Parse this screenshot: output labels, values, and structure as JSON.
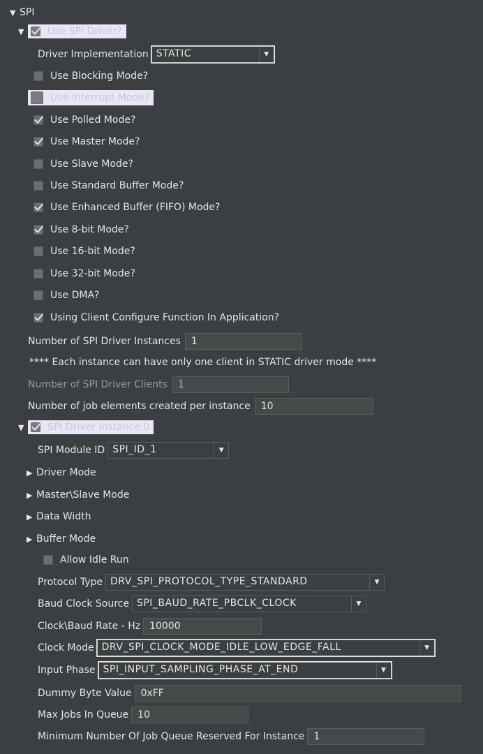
{
  "tree": {
    "root": "SPI",
    "use_driver": "Use SPI Driver?",
    "driver_impl_label": "Driver Implementation",
    "driver_impl_value": "STATIC",
    "options": [
      {
        "label": "Use Blocking Mode?",
        "checked": false
      },
      {
        "label": "Use Interrupt Mode?",
        "checked": false
      },
      {
        "label": "Use Polled Mode?",
        "checked": true
      },
      {
        "label": "Use Master Mode?",
        "checked": true
      },
      {
        "label": "Use Slave Mode?",
        "checked": false
      },
      {
        "label": "Use Standard Buffer Mode?",
        "checked": false
      },
      {
        "label": "Use Enhanced Buffer (FIFO) Mode?",
        "checked": true
      },
      {
        "label": "Use 8-bit Mode?",
        "checked": true
      },
      {
        "label": "Use 16-bit Mode?",
        "checked": false
      },
      {
        "label": "Use 32-bit Mode?",
        "checked": false
      },
      {
        "label": "Use DMA?",
        "checked": false
      },
      {
        "label": "Using Client Configure Function In Application?",
        "checked": true
      }
    ],
    "num_instances_label": "Number of SPI Driver Instances",
    "num_instances_value": "1",
    "note": "**** Each instance can have only one client in STATIC driver mode ****",
    "num_clients_label": "Number of SPI Driver Clients",
    "num_clients_value": "1",
    "job_elements_label": "Number of job elements created per instance",
    "job_elements_value": "10",
    "instance0": "SPI Driver Instance 0",
    "module_id_label": "SPI Module ID",
    "module_id_value": "SPI_ID_1",
    "groups": [
      "Driver Mode",
      "Master\\Slave Mode",
      "Data Width",
      "Buffer Mode"
    ],
    "allow_idle": "Allow Idle Run",
    "protocol_label": "Protocol Type",
    "protocol_value": "DRV_SPI_PROTOCOL_TYPE_STANDARD",
    "baud_src_label": "Baud Clock Source",
    "baud_src_value": "SPI_BAUD_RATE_PBCLK_CLOCK",
    "baud_rate_label": "Clock\\Baud Rate - Hz",
    "baud_rate_value": "10000",
    "clock_mode_label": "Clock Mode",
    "clock_mode_value": "DRV_SPI_CLOCK_MODE_IDLE_LOW_EDGE_FALL",
    "input_phase_label": "Input Phase",
    "input_phase_value": "SPI_INPUT_SAMPLING_PHASE_AT_END",
    "dummy_label": "Dummy Byte Value",
    "dummy_value": "0xFF",
    "max_jobs_label": "Max Jobs In Queue",
    "max_jobs_value": "10",
    "min_jobs_label": "Minimum Number Of Job Queue Reserved For Instance",
    "min_jobs_value": "1"
  }
}
